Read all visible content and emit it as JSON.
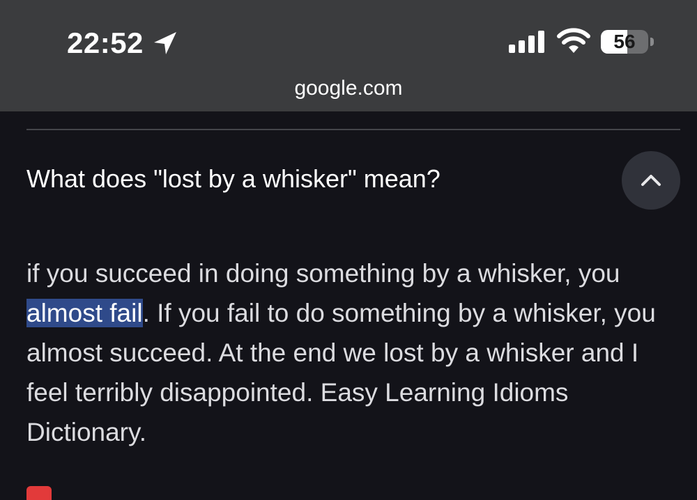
{
  "status_bar": {
    "time": "22:52",
    "battery_level": "56",
    "battery_fraction": 0.56,
    "icons": [
      "location-arrow-icon",
      "cellular-signal-icon",
      "wifi-icon",
      "battery-icon"
    ]
  },
  "browser": {
    "url": "google.com"
  },
  "faq": {
    "question": "What does \"lost by a whisker\" mean?",
    "answer_before": "if you succeed in doing something by a whisker, you ",
    "answer_highlight": "almost fail",
    "answer_after": ". If you fail to do something by a whisker, you almost succeed. At the end we lost by a whisker and I feel terribly disappointed. Easy Learning Idioms Dictionary.",
    "expanded": true
  },
  "colors": {
    "status_bar_bg": "#3b3c3e",
    "page_bg": "#131319",
    "highlight": "#2f4a8a",
    "favicon": "#e23a3a"
  }
}
